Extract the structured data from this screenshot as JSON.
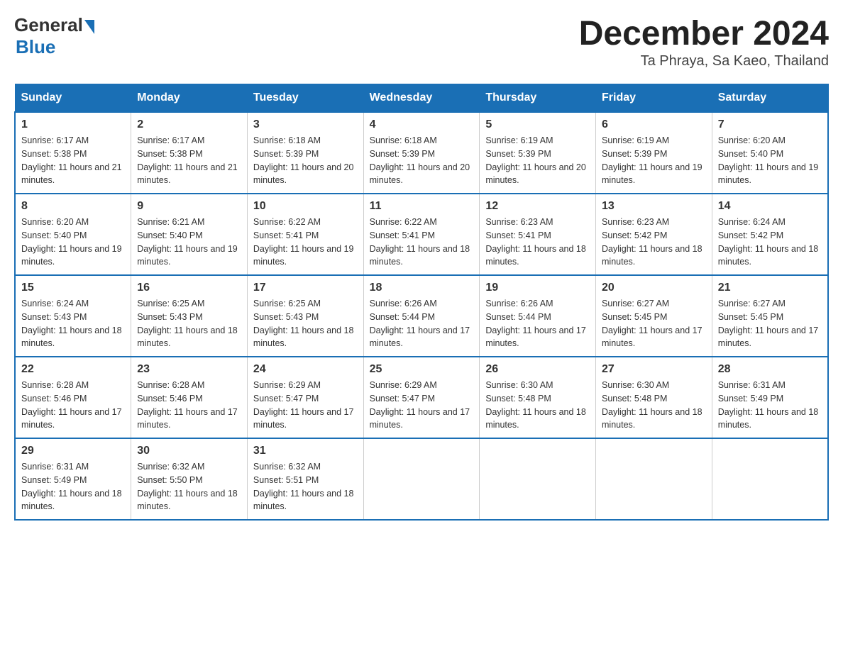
{
  "header": {
    "logo_general": "General",
    "logo_blue": "Blue",
    "month_year": "December 2024",
    "location": "Ta Phraya, Sa Kaeo, Thailand"
  },
  "weekdays": [
    "Sunday",
    "Monday",
    "Tuesday",
    "Wednesday",
    "Thursday",
    "Friday",
    "Saturday"
  ],
  "weeks": [
    [
      {
        "day": "1",
        "sunrise": "6:17 AM",
        "sunset": "5:38 PM",
        "daylight": "11 hours and 21 minutes."
      },
      {
        "day": "2",
        "sunrise": "6:17 AM",
        "sunset": "5:38 PM",
        "daylight": "11 hours and 21 minutes."
      },
      {
        "day": "3",
        "sunrise": "6:18 AM",
        "sunset": "5:39 PM",
        "daylight": "11 hours and 20 minutes."
      },
      {
        "day": "4",
        "sunrise": "6:18 AM",
        "sunset": "5:39 PM",
        "daylight": "11 hours and 20 minutes."
      },
      {
        "day": "5",
        "sunrise": "6:19 AM",
        "sunset": "5:39 PM",
        "daylight": "11 hours and 20 minutes."
      },
      {
        "day": "6",
        "sunrise": "6:19 AM",
        "sunset": "5:39 PM",
        "daylight": "11 hours and 19 minutes."
      },
      {
        "day": "7",
        "sunrise": "6:20 AM",
        "sunset": "5:40 PM",
        "daylight": "11 hours and 19 minutes."
      }
    ],
    [
      {
        "day": "8",
        "sunrise": "6:20 AM",
        "sunset": "5:40 PM",
        "daylight": "11 hours and 19 minutes."
      },
      {
        "day": "9",
        "sunrise": "6:21 AM",
        "sunset": "5:40 PM",
        "daylight": "11 hours and 19 minutes."
      },
      {
        "day": "10",
        "sunrise": "6:22 AM",
        "sunset": "5:41 PM",
        "daylight": "11 hours and 19 minutes."
      },
      {
        "day": "11",
        "sunrise": "6:22 AM",
        "sunset": "5:41 PM",
        "daylight": "11 hours and 18 minutes."
      },
      {
        "day": "12",
        "sunrise": "6:23 AM",
        "sunset": "5:41 PM",
        "daylight": "11 hours and 18 minutes."
      },
      {
        "day": "13",
        "sunrise": "6:23 AM",
        "sunset": "5:42 PM",
        "daylight": "11 hours and 18 minutes."
      },
      {
        "day": "14",
        "sunrise": "6:24 AM",
        "sunset": "5:42 PM",
        "daylight": "11 hours and 18 minutes."
      }
    ],
    [
      {
        "day": "15",
        "sunrise": "6:24 AM",
        "sunset": "5:43 PM",
        "daylight": "11 hours and 18 minutes."
      },
      {
        "day": "16",
        "sunrise": "6:25 AM",
        "sunset": "5:43 PM",
        "daylight": "11 hours and 18 minutes."
      },
      {
        "day": "17",
        "sunrise": "6:25 AM",
        "sunset": "5:43 PM",
        "daylight": "11 hours and 18 minutes."
      },
      {
        "day": "18",
        "sunrise": "6:26 AM",
        "sunset": "5:44 PM",
        "daylight": "11 hours and 17 minutes."
      },
      {
        "day": "19",
        "sunrise": "6:26 AM",
        "sunset": "5:44 PM",
        "daylight": "11 hours and 17 minutes."
      },
      {
        "day": "20",
        "sunrise": "6:27 AM",
        "sunset": "5:45 PM",
        "daylight": "11 hours and 17 minutes."
      },
      {
        "day": "21",
        "sunrise": "6:27 AM",
        "sunset": "5:45 PM",
        "daylight": "11 hours and 17 minutes."
      }
    ],
    [
      {
        "day": "22",
        "sunrise": "6:28 AM",
        "sunset": "5:46 PM",
        "daylight": "11 hours and 17 minutes."
      },
      {
        "day": "23",
        "sunrise": "6:28 AM",
        "sunset": "5:46 PM",
        "daylight": "11 hours and 17 minutes."
      },
      {
        "day": "24",
        "sunrise": "6:29 AM",
        "sunset": "5:47 PM",
        "daylight": "11 hours and 17 minutes."
      },
      {
        "day": "25",
        "sunrise": "6:29 AM",
        "sunset": "5:47 PM",
        "daylight": "11 hours and 17 minutes."
      },
      {
        "day": "26",
        "sunrise": "6:30 AM",
        "sunset": "5:48 PM",
        "daylight": "11 hours and 18 minutes."
      },
      {
        "day": "27",
        "sunrise": "6:30 AM",
        "sunset": "5:48 PM",
        "daylight": "11 hours and 18 minutes."
      },
      {
        "day": "28",
        "sunrise": "6:31 AM",
        "sunset": "5:49 PM",
        "daylight": "11 hours and 18 minutes."
      }
    ],
    [
      {
        "day": "29",
        "sunrise": "6:31 AM",
        "sunset": "5:49 PM",
        "daylight": "11 hours and 18 minutes."
      },
      {
        "day": "30",
        "sunrise": "6:32 AM",
        "sunset": "5:50 PM",
        "daylight": "11 hours and 18 minutes."
      },
      {
        "day": "31",
        "sunrise": "6:32 AM",
        "sunset": "5:51 PM",
        "daylight": "11 hours and 18 minutes."
      },
      null,
      null,
      null,
      null
    ]
  ]
}
